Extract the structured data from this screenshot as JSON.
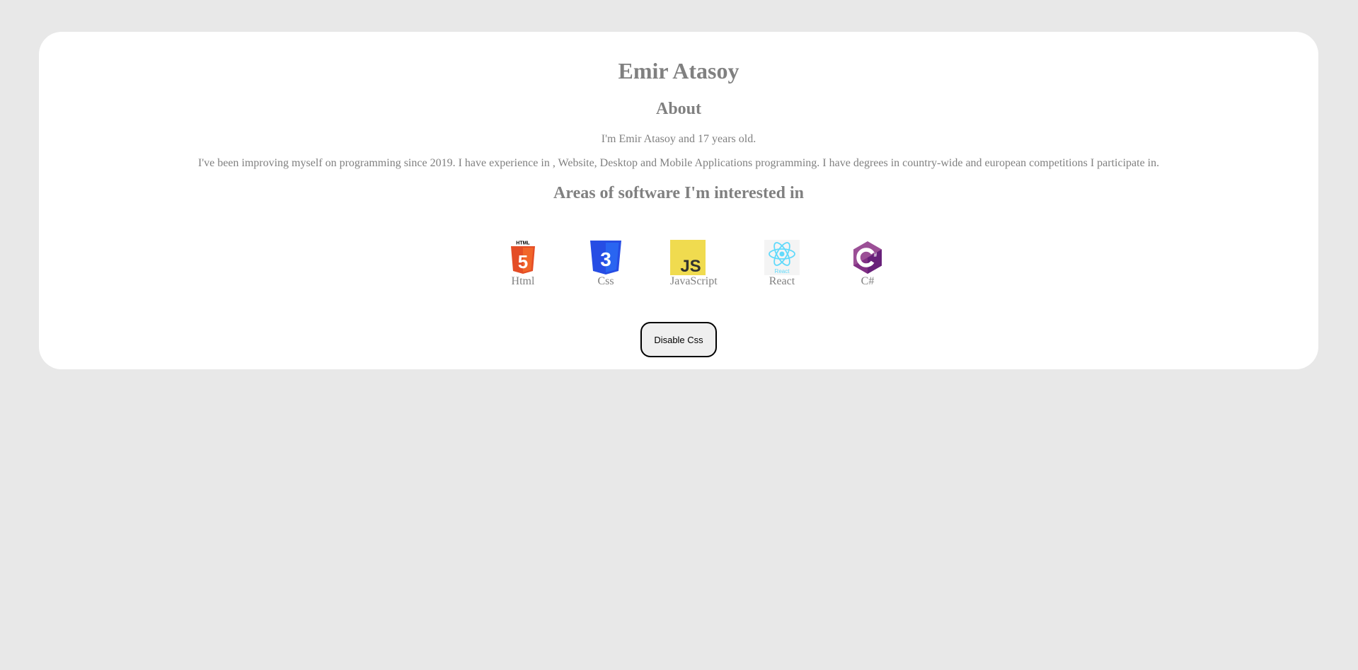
{
  "profile": {
    "name": "Emir Atasoy"
  },
  "about": {
    "title": "About",
    "intro": "I'm Emir Atasoy and 17 years old.",
    "description": "I've been improving myself on programming since 2019. I have experience in , Website, Desktop and Mobile Applications programming. I have degrees in country-wide and european competitions I participate in."
  },
  "areas": {
    "title": "Areas of software I'm interested in",
    "skills": [
      {
        "label": "Html",
        "icon": "html5-icon"
      },
      {
        "label": "Css",
        "icon": "css3-icon"
      },
      {
        "label": "JavaScript",
        "icon": "javascript-icon"
      },
      {
        "label": "React",
        "icon": "react-icon"
      },
      {
        "label": "C#",
        "icon": "csharp-icon"
      }
    ]
  },
  "logo_text": {
    "html": "HTML",
    "html_digit": "5",
    "css_digit": "3",
    "js": "JS",
    "react": "React",
    "csharp": "C"
  },
  "toggle": {
    "label": "Disable Css"
  },
  "colors": {
    "background": "#e8e8e8",
    "card": "#ffffff",
    "text": "#808080",
    "html5": "#e44d26",
    "css3": "#264de4",
    "js": "#f0db4f",
    "react": "#61dafb",
    "csharp": "#68217a"
  }
}
